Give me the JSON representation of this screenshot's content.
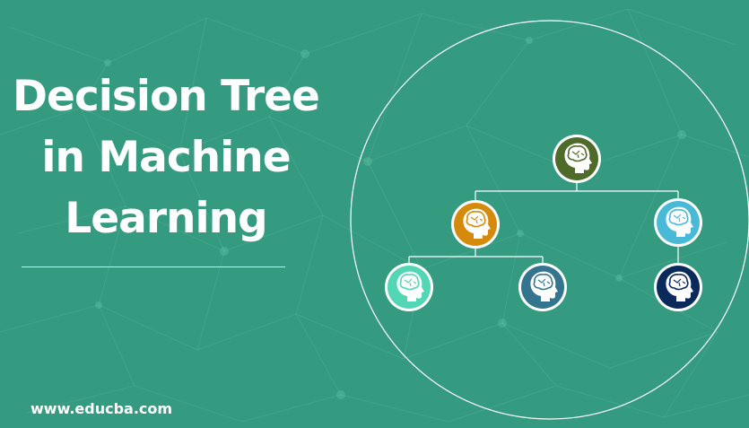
{
  "title": {
    "line1": "Decision Tree",
    "line2": "in Machine",
    "line3": "Learning"
  },
  "footer": {
    "url": "www.educba.com"
  },
  "colors": {
    "background": "#349a80",
    "root_node": "#4f6b2a",
    "left_branch_node": "#d68a0c",
    "right_branch_node": "#49b9d8",
    "left_left_leaf": "#52d6b4",
    "left_right_leaf": "#33758e",
    "right_leaf": "#0b2a5c",
    "lines": "#ffffff"
  },
  "nodes": [
    {
      "id": "root",
      "icon": "brain-head-icon",
      "color": "#4f6b2a"
    },
    {
      "id": "left",
      "icon": "brain-head-icon",
      "color": "#d68a0c"
    },
    {
      "id": "right",
      "icon": "brain-head-icon",
      "color": "#49b9d8"
    },
    {
      "id": "left-left",
      "icon": "brain-head-icon",
      "color": "#52d6b4"
    },
    {
      "id": "left-right",
      "icon": "brain-head-icon",
      "color": "#33758e"
    },
    {
      "id": "right-child",
      "icon": "brain-head-icon",
      "color": "#0b2a5c"
    }
  ]
}
